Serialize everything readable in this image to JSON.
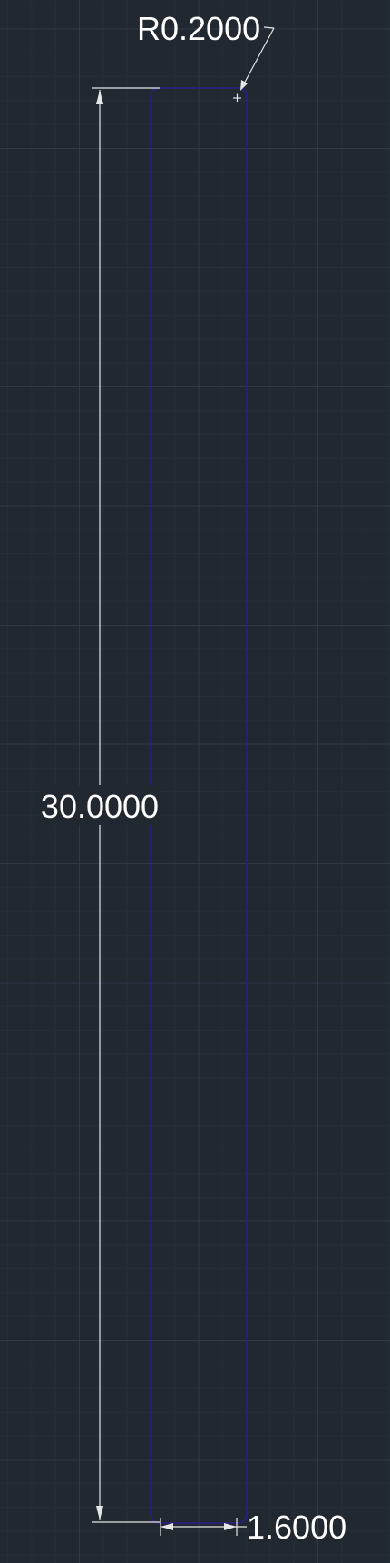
{
  "drawing": {
    "background_color": "#212830",
    "grid_color": "#2f3a46",
    "part_edge_color": "#2a1f8a",
    "dimension_color": "#e6e6e6",
    "text_color": "#ffffff"
  },
  "dimensions": {
    "radius_label": "R0.2000",
    "length_label": "30.0000",
    "width_label": "1.6000"
  },
  "markers": {
    "center_mark_icon": "crosshair-plus"
  }
}
